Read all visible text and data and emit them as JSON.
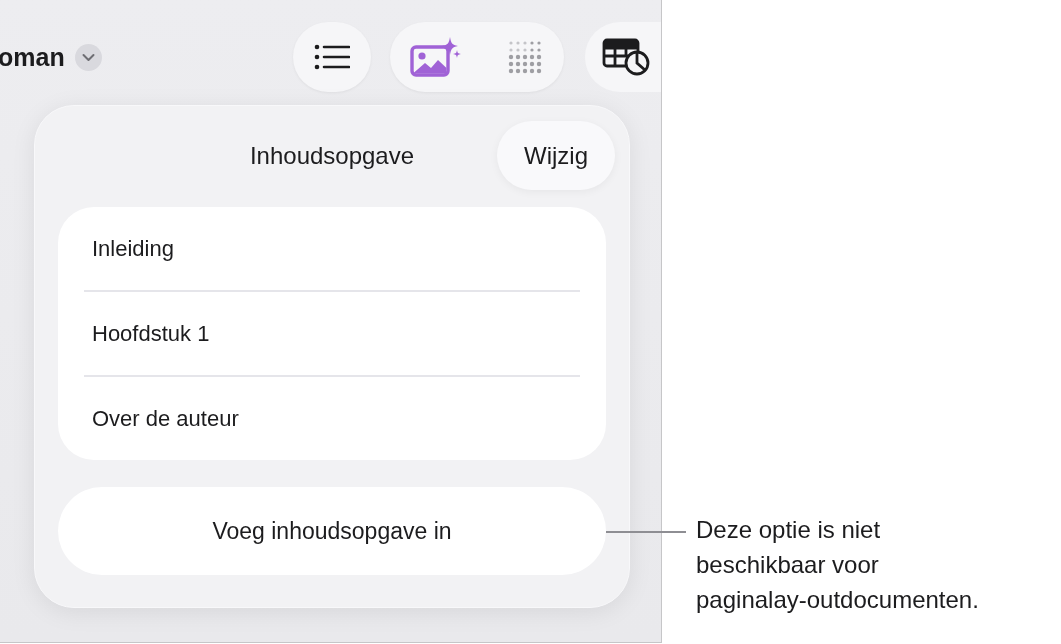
{
  "toolbar": {
    "font_menu": {
      "label": "oman"
    }
  },
  "popover": {
    "title": "Inhoudsopgave",
    "edit_button": "Wijzig",
    "entries": [
      {
        "label": "Inleiding"
      },
      {
        "label": "Hoofdstuk 1"
      },
      {
        "label": "Over de auteur"
      }
    ],
    "insert_button": "Voeg inhoudsopgave in"
  },
  "callout": {
    "lines": [
      "Deze optie is niet",
      "beschikbaar voor",
      "paginalay-outdocumenten."
    ]
  }
}
